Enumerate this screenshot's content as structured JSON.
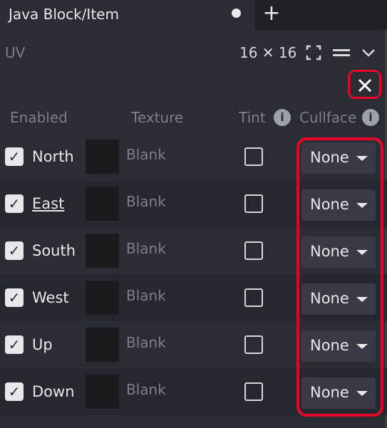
{
  "tab": {
    "title": "Java Block/Item",
    "add_label": "+"
  },
  "uv": {
    "label": "UV",
    "size": "16 ✕ 16"
  },
  "columns": {
    "enabled": "Enabled",
    "texture": "Texture",
    "tint": "Tint",
    "cullface": "Cullface"
  },
  "faces": [
    {
      "name": "North",
      "enabled": true,
      "texture": "Blank",
      "tint": false,
      "cullface": "None"
    },
    {
      "name": "East",
      "enabled": true,
      "texture": "Blank",
      "tint": false,
      "cullface": "None"
    },
    {
      "name": "South",
      "enabled": true,
      "texture": "Blank",
      "tint": false,
      "cullface": "None"
    },
    {
      "name": "West",
      "enabled": true,
      "texture": "Blank",
      "tint": false,
      "cullface": "None"
    },
    {
      "name": "Up",
      "enabled": true,
      "texture": "Blank",
      "tint": false,
      "cullface": "None"
    },
    {
      "name": "Down",
      "enabled": true,
      "texture": "Blank",
      "tint": false,
      "cullface": "None"
    }
  ],
  "icons": {
    "tab_modified": "unsaved-dot-icon",
    "fullscreen": "fullscreen-icon",
    "menu": "menu-icon",
    "collapse": "chevron-down-icon",
    "close": "close-icon",
    "info": "info-icon",
    "checkbox": "checkbox-checked-icon",
    "dropdown": "caret-down-icon"
  },
  "colors": {
    "background": "#2a2d34",
    "annotation": "#e8002a"
  }
}
